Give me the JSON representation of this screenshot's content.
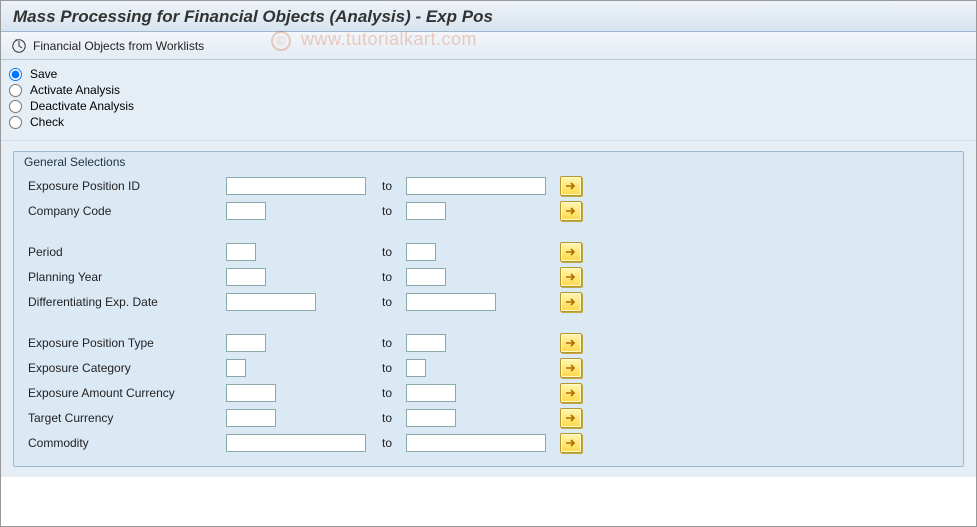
{
  "title": "Mass Processing for Financial Objects (Analysis) - Exp Pos",
  "toolbar": {
    "item_label": "Financial Objects from Worklists"
  },
  "watermark": {
    "copy": "©",
    "text": "www.tutorialkart.com"
  },
  "radios": {
    "selected": "save",
    "options": [
      {
        "key": "save",
        "label": "Save"
      },
      {
        "key": "activate",
        "label": "Activate Analysis"
      },
      {
        "key": "deactivate",
        "label": "Deactivate Analysis"
      },
      {
        "key": "check",
        "label": "Check"
      }
    ]
  },
  "group": {
    "title": "General Selections",
    "to_label": "to",
    "rows": [
      {
        "key": "exposure_position_id",
        "label": "Exposure Position ID",
        "from_w": 140,
        "to_w": 140,
        "from": "",
        "to": ""
      },
      {
        "key": "company_code",
        "label": "Company Code",
        "from_w": 40,
        "to_w": 40,
        "from": "",
        "to": ""
      },
      {
        "spacer": true
      },
      {
        "key": "period",
        "label": "Period",
        "from_w": 30,
        "to_w": 30,
        "from": "",
        "to": ""
      },
      {
        "key": "planning_year",
        "label": "Planning Year",
        "from_w": 40,
        "to_w": 40,
        "from": "",
        "to": ""
      },
      {
        "key": "diff_exp_date",
        "label": "Differentiating Exp. Date",
        "from_w": 90,
        "to_w": 90,
        "from": "",
        "to": ""
      },
      {
        "spacer": true
      },
      {
        "key": "exposure_position_type",
        "label": "Exposure Position Type",
        "from_w": 40,
        "to_w": 40,
        "from": "",
        "to": ""
      },
      {
        "key": "exposure_category",
        "label": "Exposure Category",
        "from_w": 20,
        "to_w": 20,
        "from": "",
        "to": ""
      },
      {
        "key": "exposure_amount_ccy",
        "label": "Exposure Amount Currency",
        "from_w": 50,
        "to_w": 50,
        "from": "",
        "to": ""
      },
      {
        "key": "target_currency",
        "label": "Target Currency",
        "from_w": 50,
        "to_w": 50,
        "from": "",
        "to": ""
      },
      {
        "key": "commodity",
        "label": "Commodity",
        "from_w": 140,
        "to_w": 140,
        "from": "",
        "to": ""
      }
    ]
  }
}
